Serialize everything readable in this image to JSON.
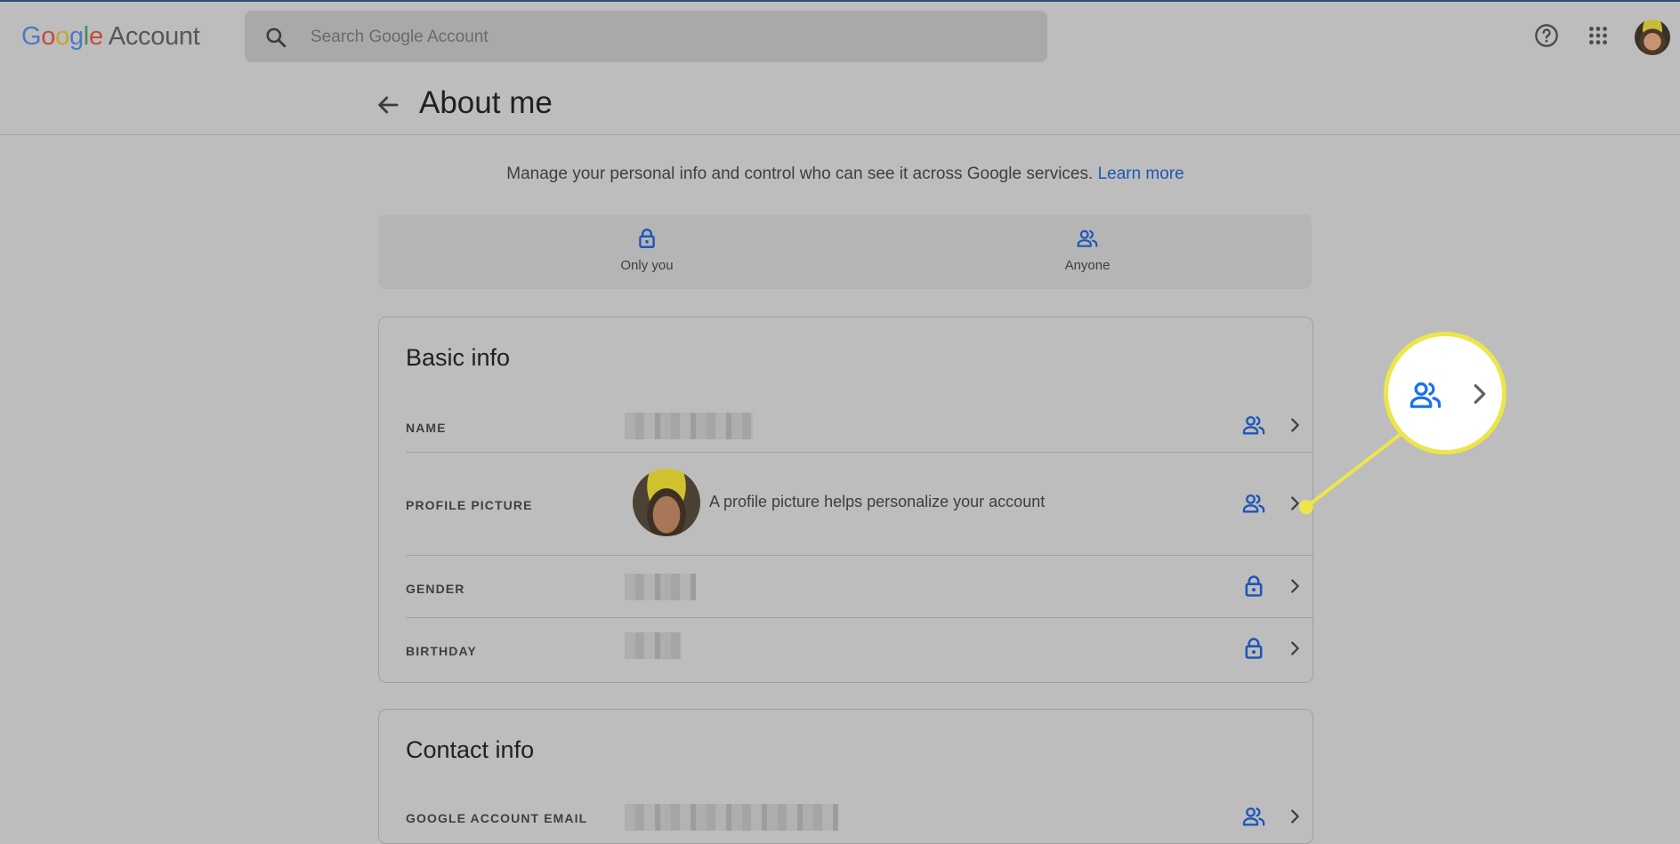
{
  "header": {
    "logo_letters": [
      "G",
      "o",
      "o",
      "g",
      "l",
      "e"
    ],
    "product": "Account",
    "search_placeholder": "Search Google Account",
    "icons": [
      "search-icon",
      "help-icon",
      "apps-grid-icon",
      "account-avatar"
    ]
  },
  "page": {
    "title": "About me",
    "intro": "Manage your personal info and control who can see it across Google services.",
    "learn_more": "Learn more"
  },
  "legend": [
    {
      "label": "Only you",
      "icon": "lock-icon"
    },
    {
      "label": "Anyone",
      "icon": "people-icon"
    }
  ],
  "basic_info": {
    "title": "Basic info",
    "rows": [
      {
        "label": "NAME",
        "visibility": "people-icon"
      },
      {
        "label": "PROFILE PICTURE",
        "value": "A profile picture helps personalize your account",
        "visibility": "people-icon"
      },
      {
        "label": "GENDER",
        "visibility": "lock-icon"
      },
      {
        "label": "BIRTHDAY",
        "visibility": "lock-icon"
      }
    ]
  },
  "contact_info": {
    "title": "Contact info",
    "rows": [
      {
        "label": "GOOGLE ACCOUNT EMAIL",
        "visibility": "people-icon"
      }
    ]
  },
  "colors": {
    "accent_blue": "#1e56b8",
    "callout_yellow": "#ece64a",
    "overlay_gray": "#bdbdbd"
  }
}
